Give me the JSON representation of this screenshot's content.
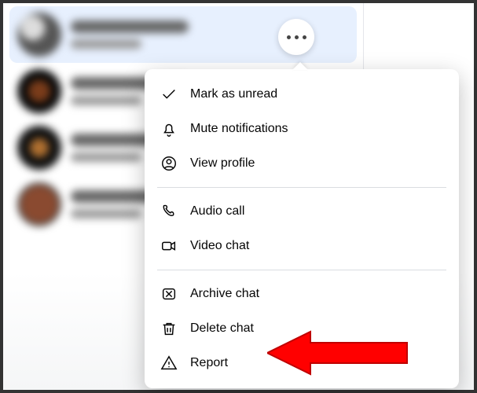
{
  "menu": {
    "mark_unread": "Mark as unread",
    "mute": "Mute notifications",
    "view_profile": "View profile",
    "audio_call": "Audio call",
    "video_chat": "Video chat",
    "archive": "Archive chat",
    "delete": "Delete chat",
    "report": "Report"
  }
}
